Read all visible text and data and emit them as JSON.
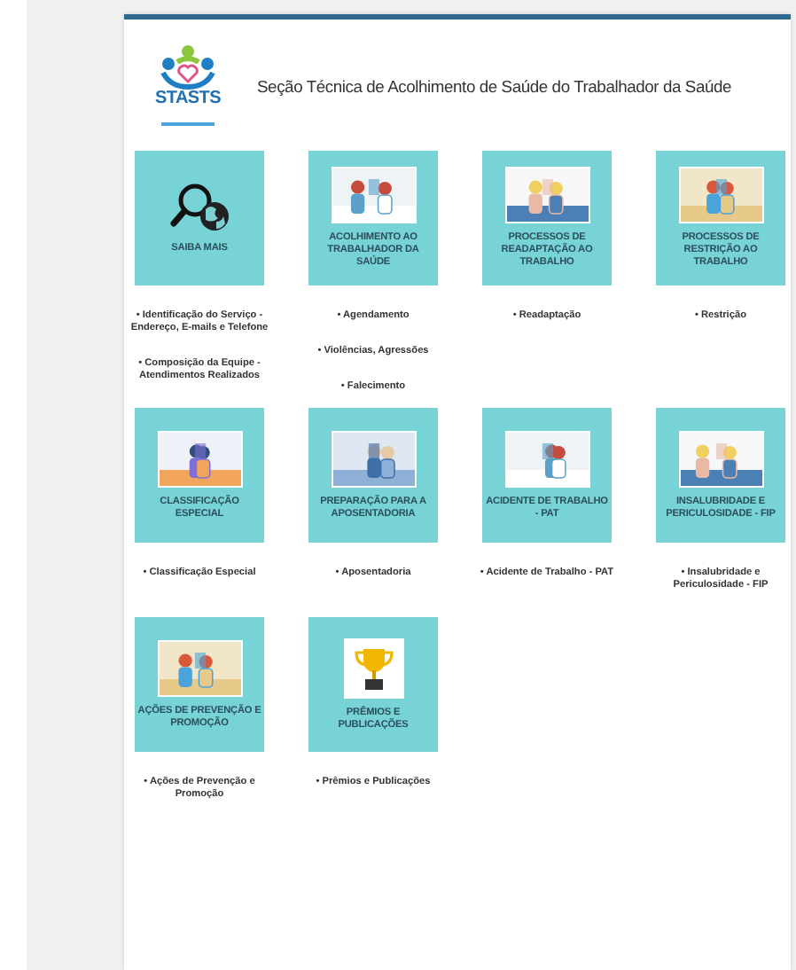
{
  "header": {
    "logo_text": "STASTS",
    "title": "Seção Técnica de Acolhimento de Saúde do Trabalhador da Saúde"
  },
  "tiles": [
    {
      "title": "SAIBA MAIS",
      "kind": "icon",
      "links": [
        "• Identificação do Serviço - Endereço, E-mails e Telefone",
        "• Composição da Equipe - Atendimentos Realizados"
      ]
    },
    {
      "title": "ACOLHIMENTO AO TRABALHADOR DA SAÚDE",
      "kind": "picture",
      "links": [
        "• Agendamento",
        "• Violências, Agressões",
        "• Falecimento"
      ]
    },
    {
      "title": "PROCESSOS DE READAPTAÇÃO AO TRABALHO",
      "kind": "picture",
      "links": [
        "• Readaptação"
      ]
    },
    {
      "title": "PROCESSOS DE RESTRIÇÃO AO TRABALHO",
      "kind": "picture",
      "links": [
        "• Restrição"
      ]
    },
    {
      "title": "CLASSIFICAÇÃO ESPECIAL",
      "kind": "picture",
      "links": [
        "• Classificação Especial"
      ]
    },
    {
      "title": "PREPARAÇÃO PARA A APOSENTADORIA",
      "kind": "picture",
      "links": [
        "• Aposentadoria"
      ]
    },
    {
      "title": "ACIDENTE DE TRABALHO - PAT",
      "kind": "picture",
      "links": [
        "• Acidente de Trabalho - PAT"
      ]
    },
    {
      "title": "INSALUBRIDADE E PERICULOSIDADE - FIP",
      "kind": "picture",
      "links": [
        "• Insalubridade e Periculosidade - FIP"
      ]
    },
    {
      "title": "AÇÕES DE PREVENÇÃO E PROMOÇÃO",
      "kind": "picture",
      "links": [
        "• Ações de Prevenção e Promoção"
      ]
    },
    {
      "title": "PRÊMIOS E PUBLICAÇÕES",
      "kind": "trophy",
      "links": [
        "• Prêmios e Publicações"
      ]
    }
  ]
}
